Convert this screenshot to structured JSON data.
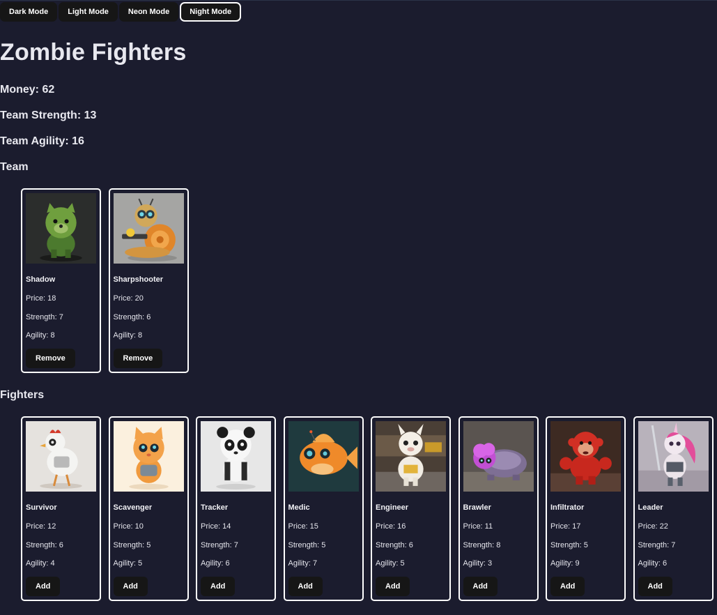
{
  "modes": [
    {
      "label": "Dark Mode",
      "active": false
    },
    {
      "label": "Light Mode",
      "active": false
    },
    {
      "label": "Neon Mode",
      "active": false
    },
    {
      "label": "Night Mode",
      "active": true
    }
  ],
  "title": "Zombie Fighters",
  "stats": {
    "money": "Money: 62",
    "strength": "Team Strength: 13",
    "agility": "Team Agility: 16"
  },
  "team_label": "Team",
  "fighters_label": "Fighters",
  "team": [
    {
      "name": "Shadow",
      "price": "Price: 18",
      "strength": "Strength: 7",
      "agility": "Agility: 8",
      "button": "Remove",
      "image": "green-bear-image"
    },
    {
      "name": "Sharpshooter",
      "price": "Price: 20",
      "strength": "Strength: 6",
      "agility": "Agility: 8",
      "button": "Remove",
      "image": "snail-gunner-image"
    }
  ],
  "fighters": [
    {
      "name": "Survivor",
      "price": "Price: 12",
      "strength": "Strength: 6",
      "agility": "Agility: 4",
      "button": "Add",
      "image": "robot-chicken-image"
    },
    {
      "name": "Scavenger",
      "price": "Price: 10",
      "strength": "Strength: 5",
      "agility": "Agility: 5",
      "button": "Add",
      "image": "orange-cat-image"
    },
    {
      "name": "Tracker",
      "price": "Price: 14",
      "strength": "Strength: 7",
      "agility": "Agility: 6",
      "button": "Add",
      "image": "robot-panda-image"
    },
    {
      "name": "Medic",
      "price": "Price: 15",
      "strength": "Strength: 5",
      "agility": "Agility: 7",
      "button": "Add",
      "image": "orange-fish-image"
    },
    {
      "name": "Engineer",
      "price": "Price: 16",
      "strength": "Strength: 6",
      "agility": "Agility: 5",
      "button": "Add",
      "image": "llama-image"
    },
    {
      "name": "Brawler",
      "price": "Price: 11",
      "strength": "Strength: 8",
      "agility": "Agility: 3",
      "button": "Add",
      "image": "purple-turtle-image"
    },
    {
      "name": "Infiltrator",
      "price": "Price: 17",
      "strength": "Strength: 5",
      "agility": "Agility: 9",
      "button": "Add",
      "image": "red-monkey-image"
    },
    {
      "name": "Leader",
      "price": "Price: 22",
      "strength": "Strength: 7",
      "agility": "Agility: 6",
      "button": "Add",
      "image": "pink-unicorn-image"
    }
  ]
}
